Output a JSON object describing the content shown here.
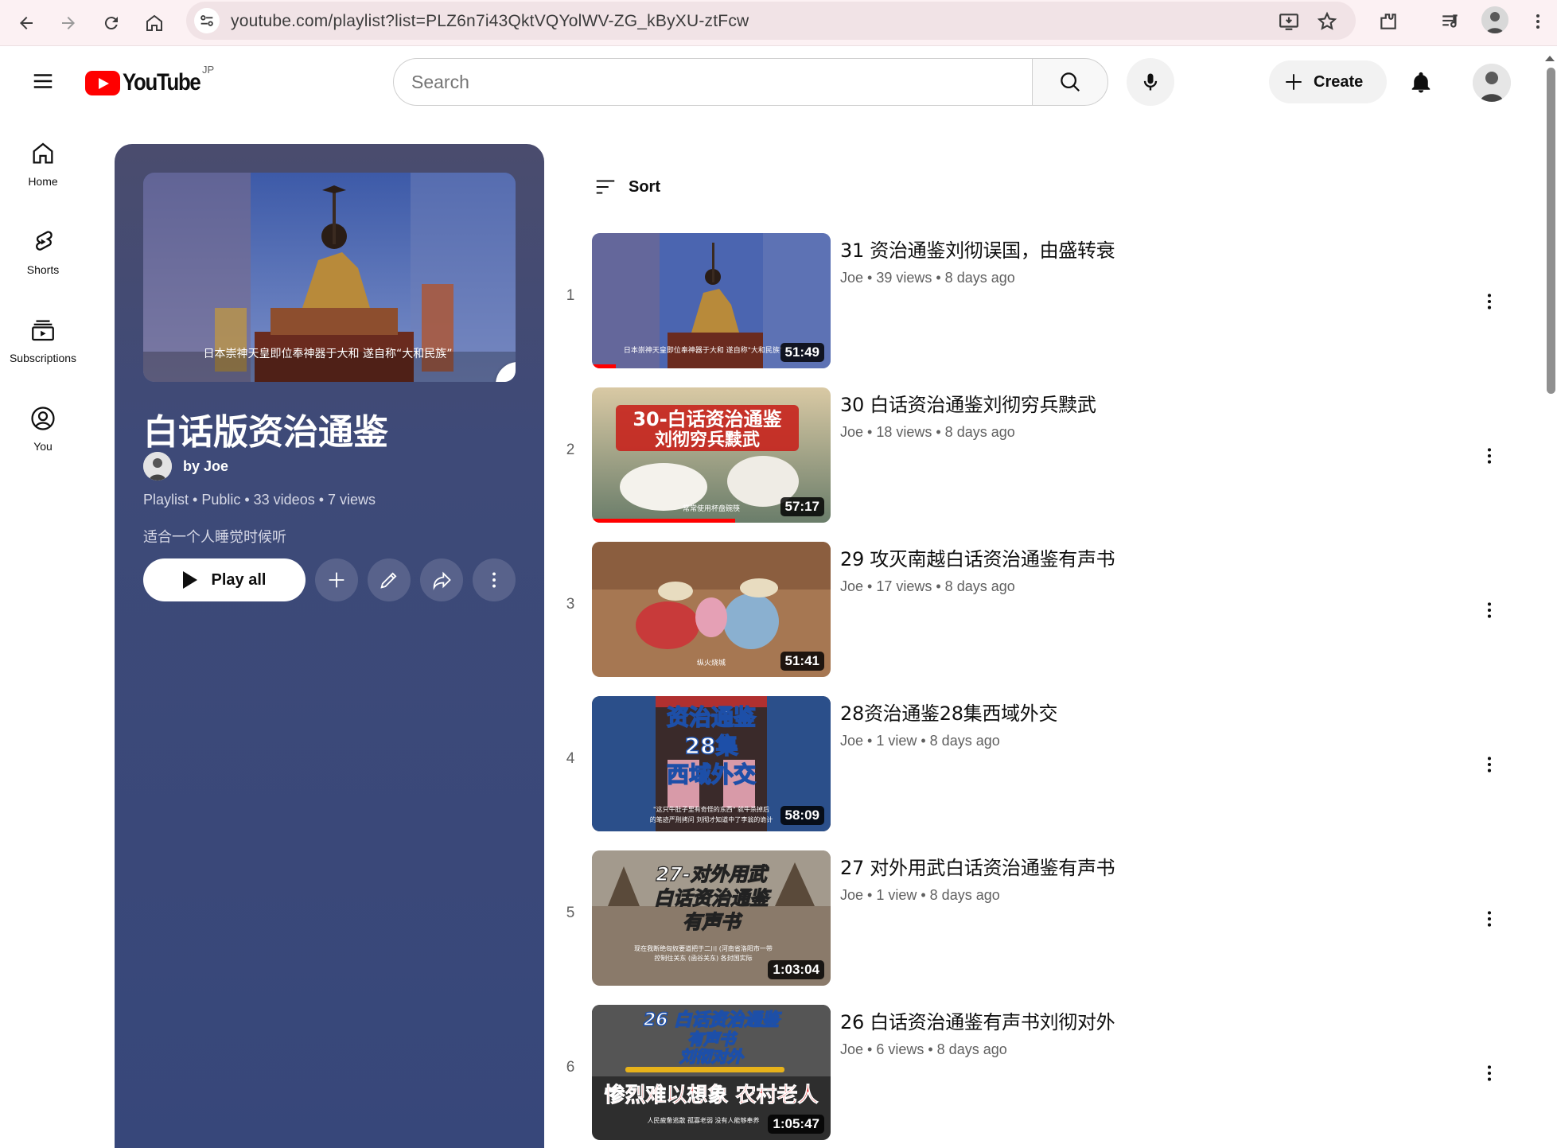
{
  "browser": {
    "url": "youtube.com/playlist?list=PLZ6n7i43QktVQYolWV-ZG_kByXU-ztFcw"
  },
  "header": {
    "logo_text": "YouTube",
    "region": "JP",
    "search_placeholder": "Search",
    "create_label": "Create"
  },
  "guide": {
    "items": [
      {
        "label": "Home",
        "icon": "home-icon"
      },
      {
        "label": "Shorts",
        "icon": "shorts-icon"
      },
      {
        "label": "Subscriptions",
        "icon": "subscriptions-icon"
      },
      {
        "label": "You",
        "icon": "you-icon"
      }
    ]
  },
  "playlist": {
    "title": "白话版资治通鉴",
    "owner": "by Joe",
    "meta": "Playlist • Public • 33 videos • 7 views",
    "description": "适合一个人睡觉时候听",
    "play_all": "Play all",
    "thumb_caption": "日本崇神天皇即位奉神器于大和 遂自称“大和民族”"
  },
  "sort_label": "Sort",
  "videos": [
    {
      "index": "1",
      "title": "31 资治通鉴刘彻误国，由盛转衰",
      "channel": "Joe",
      "stats": "39 views • 8 days ago",
      "duration": "51:49",
      "progress": 0.1
    },
    {
      "index": "2",
      "title": "30 白话资治通鉴刘彻穷兵黩武",
      "channel": "Joe",
      "stats": "18 views • 8 days ago",
      "duration": "57:17",
      "progress": 0.6,
      "thumb_text": "30-白话资治通鉴 刘彻穷兵黩武"
    },
    {
      "index": "3",
      "title": "29 攻灭南越白话资治通鉴有声书",
      "channel": "Joe",
      "stats": "17 views • 8 days ago",
      "duration": "51:41",
      "progress": 0
    },
    {
      "index": "4",
      "title": "28资治通鉴28集西域外交",
      "channel": "Joe",
      "stats": "1 view • 8 days ago",
      "duration": "58:09",
      "progress": 0,
      "thumb_text": "资治通鉴 28集 西域外交"
    },
    {
      "index": "5",
      "title": "27 对外用武白话资治通鉴有声书",
      "channel": "Joe",
      "stats": "1 view • 8 days ago",
      "duration": "1:03:04",
      "progress": 0,
      "thumb_text": "27-对外用武 白话资治通鉴 有声书"
    },
    {
      "index": "6",
      "title": "26 白话资治通鉴有声书刘彻对外",
      "channel": "Joe",
      "stats": "6 views • 8 days ago",
      "duration": "1:05:47",
      "progress": 0,
      "thumb_text": "26 白话资治通鉴 有声书 刘彻对外"
    }
  ],
  "colors": {
    "brand_red": "#ff0000",
    "panel_bg": "#37477a",
    "text_secondary": "#606060"
  }
}
